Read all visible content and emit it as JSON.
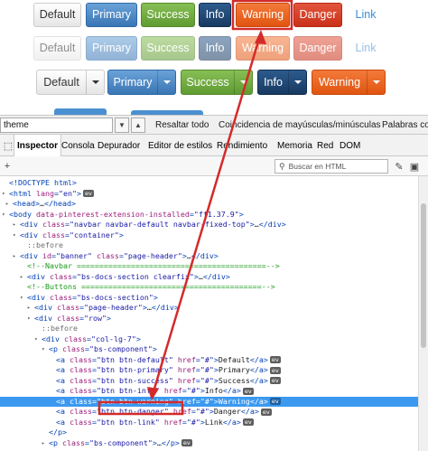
{
  "buttons": {
    "row1": [
      "Default",
      "Primary",
      "Success",
      "Info",
      "Warning",
      "Danger",
      "Link"
    ],
    "row2": [
      "Default",
      "Primary",
      "Success",
      "Info",
      "Warning",
      "Danger",
      "Link"
    ],
    "row3": [
      "Default",
      "Primary",
      "Success",
      "Info",
      "Warning"
    ]
  },
  "findbar": {
    "query": "theme",
    "options": [
      "Resaltar todo",
      "Coincidencia de mayúsculas/minúsculas",
      "Palabras com"
    ]
  },
  "tabs": [
    "Inspector",
    "Consola",
    "Depurador",
    "Editor de estilos",
    "Rendimiento",
    "Memoria",
    "Red",
    "DOM"
  ],
  "toolbar": {
    "search_placeholder": "Buscar en HTML"
  },
  "tree": {
    "lines": [
      {
        "t": "<!DOCTYPE html>"
      },
      {
        "tag": "html",
        "attrs": [
          [
            "lang",
            "en"
          ]
        ],
        "close": ">",
        "ev": "ev"
      },
      {
        "tag": "head",
        "close": ">…</head>"
      },
      {
        "tag": "body",
        "attrs": [
          [
            "data-pinterest-extension-installed",
            "ff1.37.9"
          ]
        ],
        "close": ">"
      },
      {
        "tag": "div",
        "attrs": [
          [
            "class",
            "navbar navbar-default navbar-fixed-top"
          ]
        ],
        "close": ">…</div>"
      },
      {
        "tag": "div",
        "attrs": [
          [
            "class",
            "container"
          ]
        ],
        "close": ">"
      },
      {
        "pseudo": "::before"
      },
      {
        "tag": "div",
        "attrs": [
          [
            "id",
            "banner"
          ],
          [
            "class",
            "page-header"
          ]
        ],
        "close": ">…</div>"
      },
      {
        "comment": "<!--Navbar ==========================================-->"
      },
      {
        "tag": "div",
        "attrs": [
          [
            "class",
            "bs-docs-section clearfix"
          ]
        ],
        "close": ">…</div>"
      },
      {
        "comment": "<!--Buttons ========================================-->"
      },
      {
        "tag": "div",
        "attrs": [
          [
            "class",
            "bs-docs-section"
          ]
        ],
        "close": ">"
      },
      {
        "tag": "div",
        "attrs": [
          [
            "class",
            "page-header"
          ]
        ],
        "close": ">…</div>"
      },
      {
        "tag": "div",
        "attrs": [
          [
            "class",
            "row"
          ]
        ],
        "close": ">"
      },
      {
        "pseudo": "::before"
      },
      {
        "tag": "div",
        "attrs": [
          [
            "class",
            "col-lg-7"
          ]
        ],
        "close": ">"
      },
      {
        "tag": "p",
        "attrs": [
          [
            "class",
            "bs-component"
          ]
        ],
        "close": ">"
      },
      {
        "tag": "a",
        "attrs": [
          [
            "class",
            "btn btn-default"
          ],
          [
            "href",
            "#"
          ]
        ],
        "close": ">Default</a>",
        "ev": "ev"
      },
      {
        "tag": "a",
        "attrs": [
          [
            "class",
            "btn btn-primary"
          ],
          [
            "href",
            "#"
          ]
        ],
        "close": ">Primary</a>",
        "ev": "ev"
      },
      {
        "tag": "a",
        "attrs": [
          [
            "class",
            "btn btn-success"
          ],
          [
            "href",
            "#"
          ]
        ],
        "close": ">Success</a>",
        "ev": "ev"
      },
      {
        "tag": "a",
        "attrs": [
          [
            "class",
            "btn btn-info"
          ],
          [
            "href",
            "#"
          ]
        ],
        "close": ">Info</a>",
        "ev": "ev"
      },
      {
        "tag": "a",
        "attrs": [
          [
            "class",
            "btn btn-warning"
          ],
          [
            "href",
            "#"
          ]
        ],
        "close": ">Warning</a>",
        "ev": "ev"
      },
      {
        "tag": "a",
        "attrs": [
          [
            "class",
            "btn btn-danger"
          ],
          [
            "href",
            "#"
          ]
        ],
        "close": ">Danger</a>",
        "ev": "ev"
      },
      {
        "tag": "a",
        "attrs": [
          [
            "class",
            "btn btn-link"
          ],
          [
            "href",
            "#"
          ]
        ],
        "close": ">Link</a>",
        "ev": "ev"
      },
      {
        "t": "</p>"
      },
      {
        "tag": "p",
        "attrs": [
          [
            "class",
            "bs-component"
          ]
        ],
        "close": ">…</p>",
        "ev": "ev"
      }
    ]
  },
  "colors": {
    "highlight_box": "#d42a2a",
    "arrow": "#d42a2a",
    "selection": "#3b99f0"
  }
}
